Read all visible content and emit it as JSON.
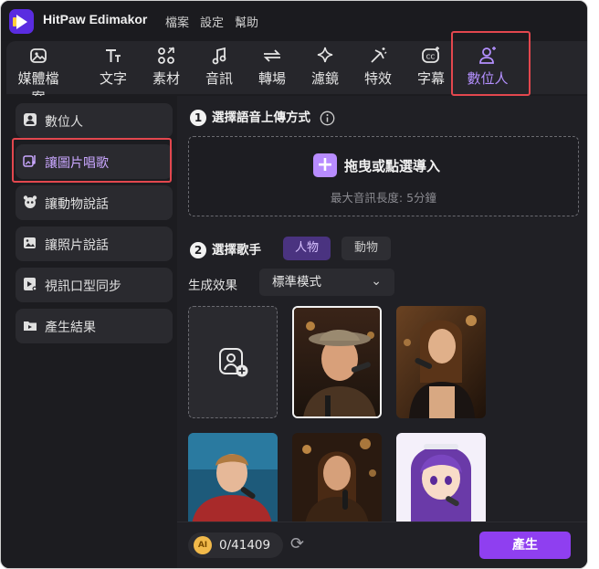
{
  "titlebar": {
    "app_name": "HitPaw Edimakor",
    "menu": [
      "檔案",
      "設定",
      "幫助"
    ]
  },
  "toolbar": {
    "tabs": [
      {
        "label": "媒體檔案",
        "icon": "media-file-icon"
      },
      {
        "label": "文字",
        "icon": "text-icon"
      },
      {
        "label": "素材",
        "icon": "materials-icon"
      },
      {
        "label": "音訊",
        "icon": "audio-icon"
      },
      {
        "label": "轉場",
        "icon": "transition-icon"
      },
      {
        "label": "濾鏡",
        "icon": "filter-icon"
      },
      {
        "label": "特效",
        "icon": "effects-icon"
      },
      {
        "label": "字幕",
        "icon": "subtitle-icon"
      },
      {
        "label": "數位人",
        "icon": "digital-human-icon"
      }
    ],
    "active_index": 8
  },
  "sidebar": {
    "items": [
      {
        "label": "數位人",
        "icon": "avatar-icon"
      },
      {
        "label": "讓圖片唱歌",
        "icon": "sing-image-icon"
      },
      {
        "label": "讓動物說話",
        "icon": "animal-icon"
      },
      {
        "label": "讓照片說話",
        "icon": "photo-talk-icon"
      },
      {
        "label": "視訊口型同步",
        "icon": "lipsync-icon"
      },
      {
        "label": "產生結果",
        "icon": "result-icon"
      }
    ],
    "active_index": 1
  },
  "step1": {
    "number": "1",
    "title": "選擇語音上傳方式",
    "info_icon": "info-icon",
    "drop_label": "拖曳或點選導入",
    "drop_hint": "最大音訊長度: 5分鐘"
  },
  "step2": {
    "number": "2",
    "title": "選擇歌手",
    "chips": [
      "人物",
      "動物"
    ],
    "active_chip": 0,
    "effect_label": "生成效果",
    "effect_value": "標準模式"
  },
  "footer": {
    "credits": "0/41409",
    "coin_label": "AI",
    "generate_label": "產生"
  },
  "colors": {
    "accent": "#b88cff",
    "generate": "#8f3ff0",
    "highlight": "#e3474e",
    "background": "#1c1c20"
  }
}
